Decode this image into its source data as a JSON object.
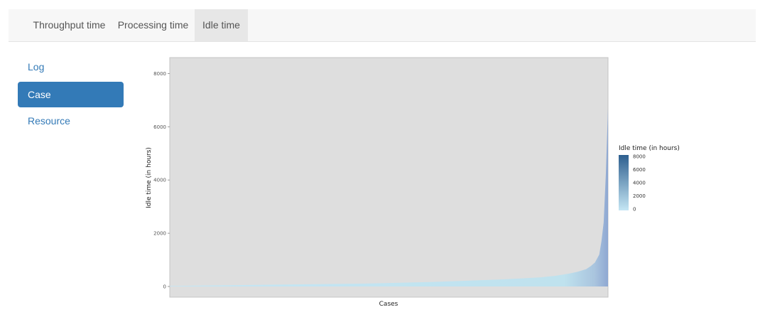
{
  "tabs": [
    {
      "label": "Throughput time",
      "active": false
    },
    {
      "label": "Processing time",
      "active": false
    },
    {
      "label": "Idle time",
      "active": true
    }
  ],
  "sidebar": {
    "items": [
      {
        "label": "Log",
        "active": false
      },
      {
        "label": "Case",
        "active": true
      },
      {
        "label": "Resource",
        "active": false
      }
    ]
  },
  "colors": {
    "accent": "#337ab7",
    "panel_background": "#dedede",
    "low": "#c5e6f4",
    "high": "#2e5f8f"
  },
  "chart_data": {
    "type": "area",
    "xlabel": "Cases",
    "ylabel": "Idle time (in hours)",
    "ylim": [
      -400,
      8600
    ],
    "yticks": [
      0,
      2000,
      4000,
      6000,
      8000
    ],
    "grid": false,
    "x_tick_labels": false,
    "x": [
      0,
      0.05,
      0.1,
      0.15,
      0.2,
      0.25,
      0.3,
      0.35,
      0.4,
      0.45,
      0.5,
      0.55,
      0.6,
      0.65,
      0.7,
      0.75,
      0.8,
      0.85,
      0.88,
      0.91,
      0.93,
      0.95,
      0.96,
      0.97,
      0.98,
      0.985,
      0.99,
      0.995,
      1.0
    ],
    "values": [
      20,
      30,
      40,
      50,
      60,
      70,
      80,
      90,
      100,
      110,
      130,
      150,
      170,
      200,
      230,
      260,
      300,
      350,
      400,
      480,
      550,
      650,
      760,
      900,
      1200,
      1700,
      2400,
      4200,
      6700
    ],
    "legend": {
      "title": "Idle time (in hours)",
      "position": "right",
      "ticks": [
        8000,
        6000,
        4000,
        2000,
        0
      ]
    }
  }
}
